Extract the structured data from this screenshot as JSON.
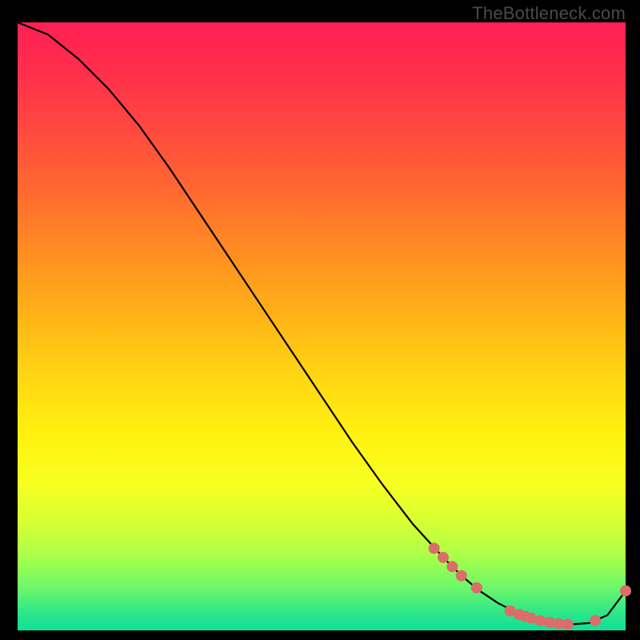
{
  "watermark": "TheBottleneck.com",
  "chart_data": {
    "type": "line",
    "title": "",
    "xlabel": "",
    "ylabel": "",
    "xlim": [
      0,
      100
    ],
    "ylim": [
      0,
      100
    ],
    "grid": false,
    "legend": false,
    "series": [
      {
        "name": "curve",
        "color": "#000000",
        "x": [
          0,
          5,
          10,
          15,
          20,
          25,
          30,
          35,
          40,
          45,
          50,
          55,
          60,
          65,
          70,
          73,
          76,
          79,
          82,
          85,
          88,
          91,
          94,
          97,
          100
        ],
        "y": [
          100,
          98,
          94,
          89,
          83,
          76,
          68.5,
          61,
          53.5,
          46,
          38.5,
          31,
          24,
          17.5,
          12,
          9,
          6.5,
          4.5,
          3,
          2,
          1.3,
          1,
          1.2,
          2.5,
          6.5
        ]
      }
    ],
    "markers": [
      {
        "name": "marker-0",
        "x": 68.5,
        "y": 13.5
      },
      {
        "name": "marker-1",
        "x": 70.0,
        "y": 12.0
      },
      {
        "name": "marker-2",
        "x": 71.5,
        "y": 10.5
      },
      {
        "name": "marker-3",
        "x": 73.0,
        "y": 9.0
      },
      {
        "name": "marker-4",
        "x": 75.5,
        "y": 7.0
      },
      {
        "name": "marker-5",
        "x": 81.0,
        "y": 3.2
      },
      {
        "name": "marker-6",
        "x": 82.5,
        "y": 2.6
      },
      {
        "name": "marker-7",
        "x": 83.5,
        "y": 2.3
      },
      {
        "name": "marker-8",
        "x": 84.5,
        "y": 2.0
      },
      {
        "name": "marker-9",
        "x": 86.0,
        "y": 1.6
      },
      {
        "name": "marker-10",
        "x": 87.5,
        "y": 1.3
      },
      {
        "name": "marker-11",
        "x": 89.0,
        "y": 1.1
      },
      {
        "name": "marker-12",
        "x": 90.5,
        "y": 1.0
      },
      {
        "name": "marker-13",
        "x": 95.0,
        "y": 1.6
      },
      {
        "name": "marker-14",
        "x": 100.0,
        "y": 6.5
      }
    ],
    "marker_style": {
      "color": "#da6e68",
      "radius": 7
    },
    "gradient_stops": [
      {
        "pos": 0.0,
        "color": "#ff1f55"
      },
      {
        "pos": 0.5,
        "color": "#ffd513"
      },
      {
        "pos": 0.8,
        "color": "#f7ff21"
      },
      {
        "pos": 1.0,
        "color": "#0fdf99"
      }
    ]
  }
}
